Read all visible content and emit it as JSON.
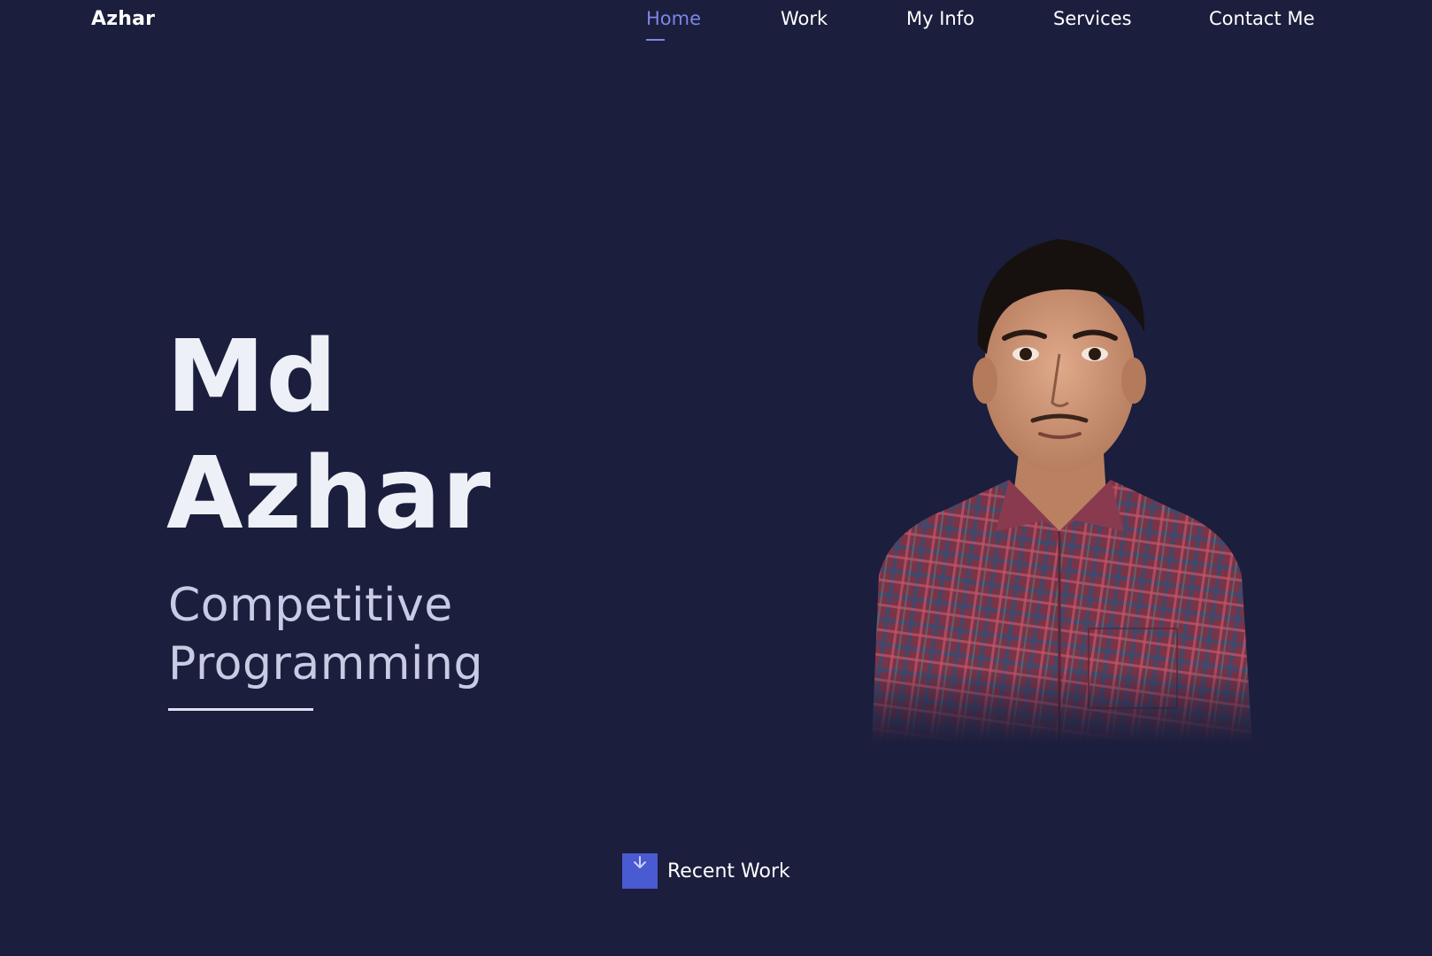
{
  "header": {
    "logo": "Azhar"
  },
  "nav": {
    "items": [
      {
        "label": "Home",
        "active": true
      },
      {
        "label": "Work",
        "active": false
      },
      {
        "label": "My Info",
        "active": false
      },
      {
        "label": "Services",
        "active": false
      },
      {
        "label": "Contact Me",
        "active": false
      }
    ]
  },
  "hero": {
    "first_name": "Md",
    "last_name": "Azhar",
    "subtitle_line1": "Competitive",
    "subtitle_line2": "Programming"
  },
  "cta": {
    "label": "Recent Work",
    "icon": "arrow-down-icon"
  },
  "colors": {
    "background": "#1b1e3c",
    "accent": "#7b86e6",
    "button": "#4a5ad0"
  }
}
